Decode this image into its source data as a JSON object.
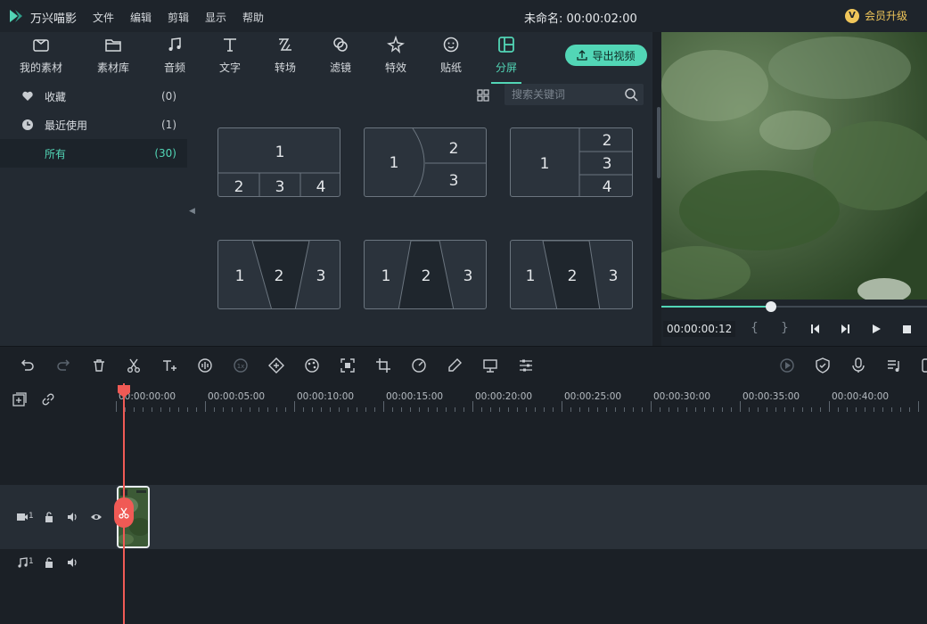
{
  "app": {
    "name": "万兴喵影",
    "menus": [
      "文件",
      "编辑",
      "剪辑",
      "显示",
      "帮助"
    ],
    "project_title": "未命名: 00:00:02:00",
    "vip_label": "会员升级"
  },
  "media_tabs": [
    {
      "label": "我的素材",
      "icon": "folder-box-icon"
    },
    {
      "label": "素材库",
      "icon": "folder-icon"
    },
    {
      "label": "音频",
      "icon": "music-note-icon"
    },
    {
      "label": "文字",
      "icon": "text-T-icon"
    },
    {
      "label": "转场",
      "icon": "transition-icon"
    },
    {
      "label": "滤镜",
      "icon": "filter-circles-icon"
    },
    {
      "label": "特效",
      "icon": "sparkle-star-icon"
    },
    {
      "label": "贴纸",
      "icon": "sticker-face-icon"
    },
    {
      "label": "分屏",
      "icon": "split-screen-icon",
      "active": true
    }
  ],
  "export_button": "导出视频",
  "categories": [
    {
      "label": "收藏",
      "count": "(0)",
      "icon": "heart-icon"
    },
    {
      "label": "最近使用",
      "count": "(1)",
      "icon": "clock-icon"
    },
    {
      "label": "所有",
      "count": "(30)",
      "active": true
    }
  ],
  "search": {
    "placeholder": "搜索关键词"
  },
  "split_templates": [
    {
      "name": "1-top-3-bottom",
      "labels": [
        "1",
        "2",
        "3",
        "4"
      ]
    },
    {
      "name": "1-left-curve-2-right",
      "labels": [
        "1",
        "2",
        "3"
      ]
    },
    {
      "name": "1-left-3-right",
      "labels": [
        "1",
        "2",
        "3",
        "4"
      ]
    },
    {
      "name": "3-diagonal-a",
      "labels": [
        "1",
        "2",
        "3"
      ]
    },
    {
      "name": "3-diagonal-b",
      "labels": [
        "1",
        "2",
        "3"
      ]
    },
    {
      "name": "3-diagonal-c",
      "labels": [
        "1",
        "2",
        "3"
      ]
    }
  ],
  "preview": {
    "timecode": "00:00:00:12",
    "mark_in": "{",
    "mark_out": "}",
    "progress": 0.41
  },
  "toolbar_icons": [
    "undo-icon",
    "redo-icon",
    "delete-icon",
    "cut-icon",
    "add-text-icon",
    "audio-wave-icon",
    "speed-icon",
    "keyframe-icon",
    "color-icon",
    "crop-fit-icon",
    "crop-icon",
    "speedometer-icon",
    "color-picker-icon",
    "green-screen-icon",
    "adjust-icon"
  ],
  "toolbar_right_icons": [
    "render-icon",
    "shield-icon",
    "microphone-icon",
    "music-list-icon"
  ],
  "ruler_labels": [
    "00:00:00:00",
    "00:00:05:00",
    "00:00:10:00",
    "00:00:15:00",
    "00:00:20:00",
    "00:00:25:00",
    "00:00:30:00",
    "00:00:35:00",
    "00:00:40:00"
  ],
  "tracks": {
    "video_number": "1",
    "audio_number": "1"
  }
}
